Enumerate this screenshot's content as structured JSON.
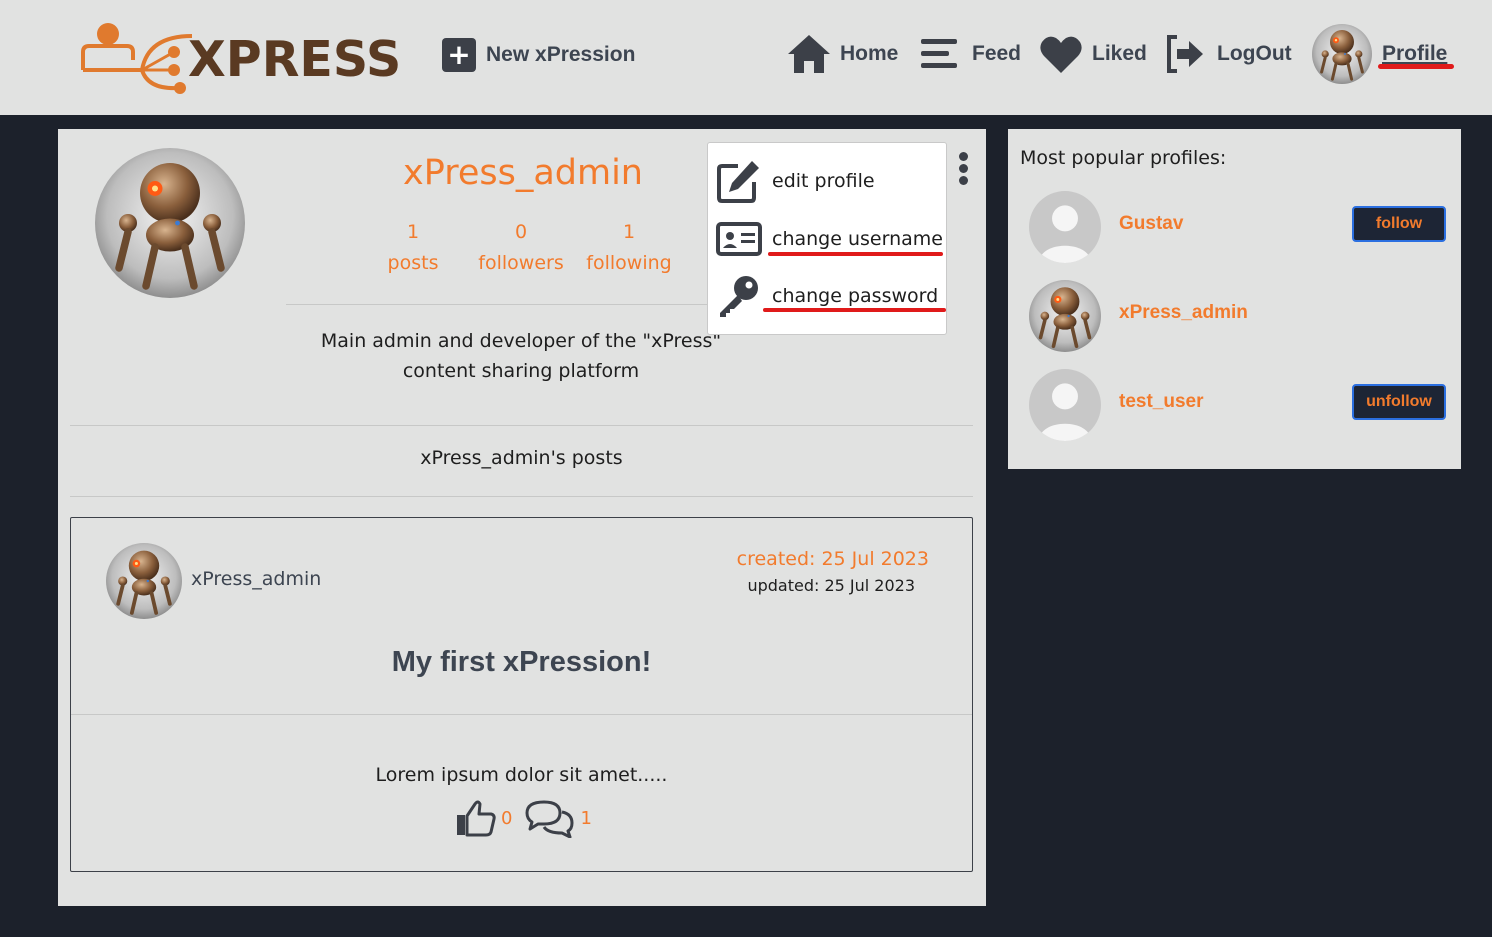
{
  "navbar": {
    "logo_text": "XPRESS",
    "new_xpression": "New xPression",
    "home": "Home",
    "feed": "Feed",
    "liked": "Liked",
    "logout": "LogOut",
    "profile": "Profile"
  },
  "profile": {
    "username": "xPress_admin",
    "stats": [
      {
        "count": "1",
        "label": "posts"
      },
      {
        "count": "0",
        "label": "followers"
      },
      {
        "count": "1",
        "label": "following"
      }
    ],
    "bio_line1": "Main admin and developer of the \"xPress\"",
    "bio_line2": "content sharing platform",
    "posts_heading": "xPress_admin's posts"
  },
  "menu": {
    "edit_profile": "edit profile",
    "change_username": "change username",
    "change_password": "change password"
  },
  "post": {
    "author": "xPress_admin",
    "created": "created: 25 Jul 2023",
    "updated": "updated: 25 Jul 2023",
    "title": "My first xPression!",
    "body": "Lorem ipsum dolor sit amet.....",
    "likes": "0",
    "comments": "1"
  },
  "sidebar": {
    "title": "Most popular profiles:",
    "profiles": [
      {
        "name": "Gustav",
        "button": "follow"
      },
      {
        "name": "xPress_admin",
        "button": ""
      },
      {
        "name": "test_user",
        "button": "unfollow"
      }
    ]
  },
  "colors": {
    "accent": "#f27b2d",
    "nav_bg": "#e1e2e1",
    "page_bg": "#1c212b",
    "highlight": "#e01a1a"
  }
}
